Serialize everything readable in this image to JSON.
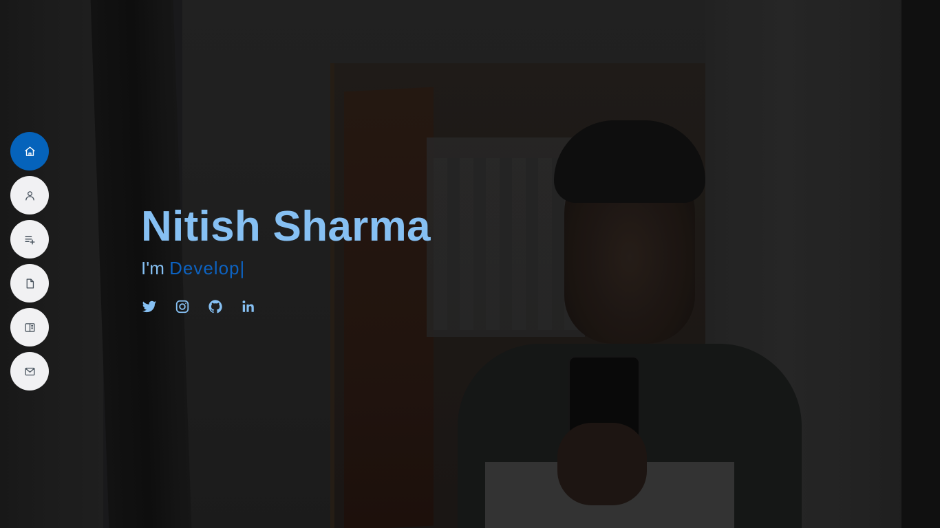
{
  "nav": {
    "items": [
      {
        "icon": "home-icon",
        "active": true
      },
      {
        "icon": "user-icon",
        "active": false
      },
      {
        "icon": "playlist-add-icon",
        "active": false
      },
      {
        "icon": "file-icon",
        "active": false
      },
      {
        "icon": "book-open-icon",
        "active": false
      },
      {
        "icon": "envelope-icon",
        "active": false
      }
    ]
  },
  "hero": {
    "name": "Nitish Sharma",
    "intro": "I'm",
    "typed_text": "Develop",
    "cursor": "|"
  },
  "social": [
    {
      "icon": "twitter-icon"
    },
    {
      "icon": "instagram-icon"
    },
    {
      "icon": "github-icon"
    },
    {
      "icon": "linkedin-icon"
    }
  ],
  "colors": {
    "accent": "#0563bb",
    "name_color": "#86c0f3",
    "typed_color": "#0d63c2",
    "nav_bg": "#f1f1f3"
  }
}
